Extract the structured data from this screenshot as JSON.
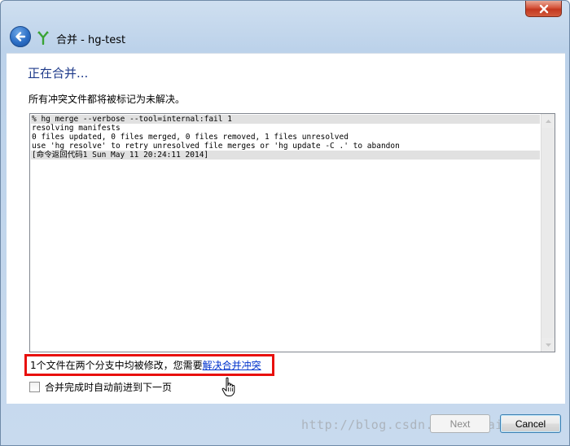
{
  "window": {
    "title": "合并 - hg-test"
  },
  "page": {
    "heading": "正在合并...",
    "subtext": "所有冲突文件都将被标记为未解决。"
  },
  "log": {
    "lines": [
      {
        "text": "% hg merge --verbose --tool=internal:fail 1",
        "highlight": true
      },
      {
        "text": "resolving manifests",
        "highlight": false
      },
      {
        "text": "0 files updated, 0 files merged, 0 files removed, 1 files unresolved",
        "highlight": false
      },
      {
        "text": "use 'hg resolve' to retry unresolved file merges or 'hg update -C .' to abandon",
        "highlight": false
      },
      {
        "text": "[命令返回代码1 Sun May 11 20:24:11 2014]",
        "highlight": true
      }
    ]
  },
  "notice": {
    "text": "1个文件在两个分支中均被修改，您需要",
    "link": "解决合并冲突"
  },
  "options": {
    "auto_next_label": "合并完成时自动前进到下一页",
    "auto_next_checked": false
  },
  "watermark": "http://blog.csdn.net/xukai871105",
  "buttons": {
    "next": "Next",
    "cancel": "Cancel"
  },
  "colors": {
    "heading": "#1e3a8a",
    "highlight_border": "#e8100c",
    "link": "#0033cc"
  }
}
